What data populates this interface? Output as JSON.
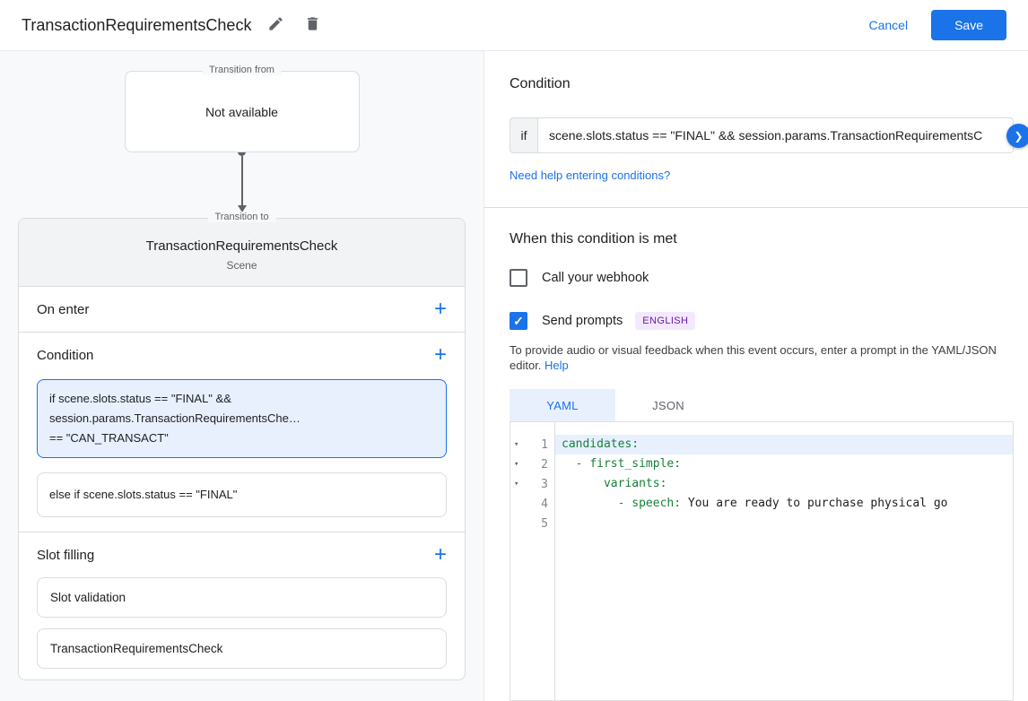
{
  "header": {
    "title": "TransactionRequirementsCheck",
    "cancel_label": "Cancel",
    "save_label": "Save"
  },
  "icons": {
    "plus": "+",
    "chevron_right": "❯",
    "fold": "▾",
    "check": "✓"
  },
  "left_panel": {
    "transition_from": {
      "label": "Transition from",
      "value": "Not available"
    },
    "transition_to_label": "Transition to",
    "scene": {
      "title": "TransactionRequirementsCheck",
      "subtitle": "Scene"
    },
    "on_enter_label": "On enter",
    "condition_label": "Condition",
    "condition_items": [
      {
        "line1": "if scene.slots.status == \"FINAL\" &&",
        "line2": "session.params.TransactionRequirementsChe…",
        "line3": "== \"CAN_TRANSACT\""
      },
      {
        "line1": "else if scene.slots.status == \"FINAL\""
      }
    ],
    "slot_filling_label": "Slot filling",
    "slot_items": [
      "Slot validation",
      "TransactionRequirementsCheck"
    ]
  },
  "right_panel": {
    "condition_heading": "Condition",
    "if_label": "if",
    "expression": "scene.slots.status == \"FINAL\" && session.params.TransactionRequirementsC",
    "conditions_help_link": "Need help entering conditions?",
    "when_met_heading": "When this condition is met",
    "webhook_label": "Call your webhook",
    "prompts_label": "Send prompts",
    "language_badge": "ENGLISH",
    "description": "To provide audio or visual feedback when this event occurs, enter a prompt in the YAML/JSON editor.",
    "help_link": "Help",
    "tabs": {
      "yaml": "YAML",
      "json": "JSON"
    },
    "code": {
      "line1": {
        "num": "1",
        "key": "candidates:"
      },
      "line2": {
        "num": "2",
        "indent": "  - ",
        "key": "first_simple:"
      },
      "line3": {
        "num": "3",
        "indent": "      ",
        "key": "variants:"
      },
      "line4": {
        "num": "4",
        "indent": "        - ",
        "key": "speech:",
        "value": " You are ready to purchase physical go"
      },
      "line5": {
        "num": "5"
      }
    }
  },
  "colors": {
    "accent_blue": "#1a73e8",
    "selected_bg": "#e8f0fe",
    "border_gray": "#dadce0",
    "header_gray": "#f1f3f4",
    "panel_gray": "#f8f9fa",
    "code_key_green": "#188038",
    "badge_bg": "#f3e8fd",
    "badge_text": "#681da8"
  }
}
